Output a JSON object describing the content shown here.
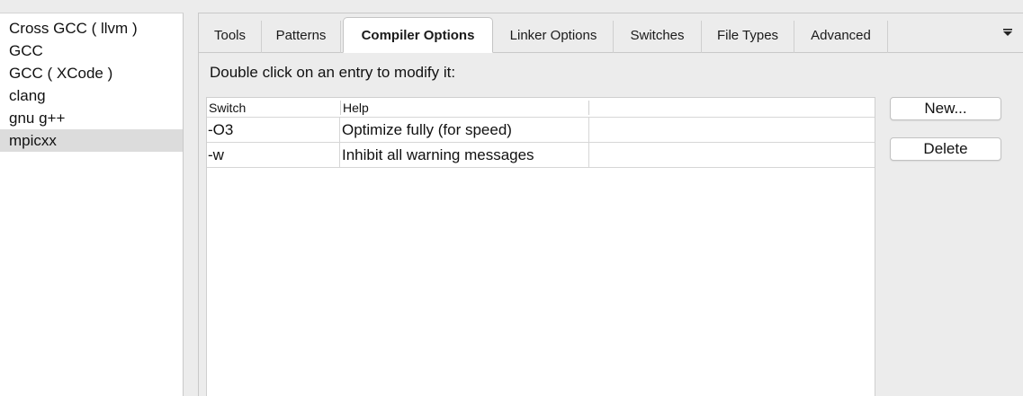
{
  "compilers": [
    {
      "label": "Cross GCC ( llvm )"
    },
    {
      "label": "GCC"
    },
    {
      "label": "GCC ( XCode )"
    },
    {
      "label": "clang"
    },
    {
      "label": "gnu g++"
    },
    {
      "label": "mpicxx",
      "selected": true
    }
  ],
  "tabs": [
    {
      "label": "Tools"
    },
    {
      "label": "Patterns"
    },
    {
      "label": "Compiler Options",
      "active": true
    },
    {
      "label": "Linker Options"
    },
    {
      "label": "Switches"
    },
    {
      "label": "File Types"
    },
    {
      "label": "Advanced"
    }
  ],
  "instruction": "Double click on an entry to modify it:",
  "table": {
    "columns": [
      "Switch",
      "Help"
    ],
    "rows": [
      [
        "-O3",
        "Optimize fully (for speed)"
      ],
      [
        "-w",
        "Inhibit all warning messages"
      ]
    ]
  },
  "buttons": {
    "new_label": "New...",
    "delete_label": "Delete"
  },
  "icons": {
    "tab_menu": "menu-dropdown-icon"
  }
}
